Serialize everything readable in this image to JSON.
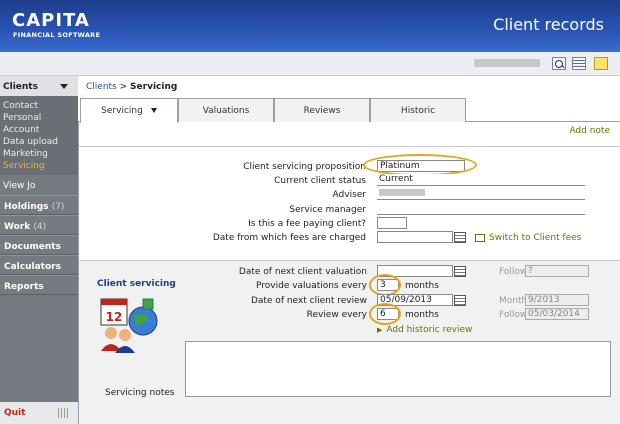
{
  "header": {
    "logo_main": "CAPITA",
    "logo_sub": "FINANCIAL SOFTWARE",
    "app_title": "Client records"
  },
  "toolbar": {
    "icons": [
      "search-icon",
      "grid-icon",
      "note-icon"
    ]
  },
  "sidebar": {
    "clients_label": "Clients",
    "sub_items": [
      "Contact",
      "Personal",
      "Account",
      "Data upload",
      "Marketing",
      "Servicing"
    ],
    "active_item": "Servicing",
    "view_label": "View Jo",
    "sections": [
      {
        "label": "Holdings",
        "count": "(7)"
      },
      {
        "label": "Work",
        "count": "(4)"
      },
      {
        "label": "Documents",
        "count": ""
      },
      {
        "label": "Calculators",
        "count": ""
      },
      {
        "label": "Reports",
        "count": ""
      }
    ],
    "quit_label": "Quit"
  },
  "breadcrumb": {
    "root": "Clients",
    "separator": ">",
    "current": "Servicing"
  },
  "tabs": [
    "Servicing",
    "Valuations",
    "Reviews",
    "Historic"
  ],
  "add_note": "Add note",
  "form": {
    "proposition_label": "Client servicing proposition",
    "proposition_value": "Platinum",
    "status_label": "Current client status",
    "status_value": "Current",
    "adviser_label": "Adviser",
    "service_manager_label": "Service manager",
    "fee_paying_label": "Is this a fee paying client?",
    "fees_date_label": "Date from which fees are charged",
    "switch_link": "Switch to Client fees"
  },
  "servicing": {
    "heading": "Client servicing",
    "next_valuation_label": "Date of next client valuation",
    "following_label": "Following",
    "following_val_value": "?",
    "valuations_every_label": "Provide valuations every",
    "valuations_every_value": "3",
    "months_label": "months",
    "next_review_label": "Date of next client review",
    "next_review_value": "05/09/2013",
    "month_label": "Month",
    "month_value": "9/2013",
    "review_every_label": "Review every",
    "review_every_value": "6",
    "following_review_value": "05/03/2014",
    "add_historic": "Add historic review",
    "notes_label": "Servicing notes"
  },
  "colors": {
    "header_blue": "#2a55b5",
    "sidebar_grey": "#767a81",
    "active_orange": "#f3b128",
    "link_green": "#5b7a00",
    "highlight": "#e6a21a"
  }
}
